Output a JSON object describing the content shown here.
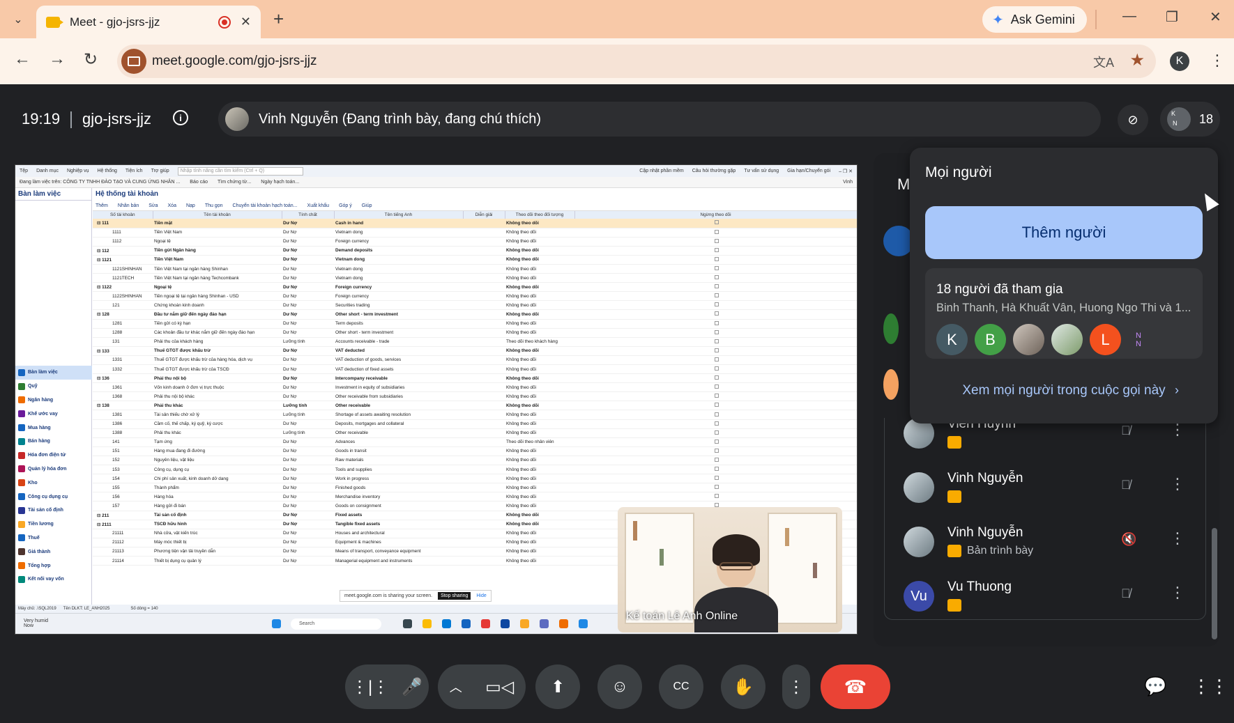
{
  "browser": {
    "tab_title": "Meet - gjo-jsrs-jjz",
    "url": "meet.google.com/gjo-jsrs-jjz",
    "gemini_label": "Ask Gemini",
    "profile_initial": "K"
  },
  "meeting": {
    "time": "19:19",
    "code": "gjo-jsrs-jjz",
    "presenter_label": "Vinh Nguyễn (Đang trình bày, đang chú thích)",
    "participant_count": "18"
  },
  "shared_screen": {
    "menu_items": [
      "Tệp",
      "Danh mục",
      "Nghiệp vụ",
      "Hệ thống",
      "Tiện ích",
      "Trợ giúp"
    ],
    "search_placeholder": "Nhập tính năng cần tìm kiếm (Ctrl + Q)",
    "right_links": [
      "Cập nhật phần mềm",
      "Câu hỏi thường gặp",
      "Tư vấn sử dụng",
      "Gia hạn/Chuyển gói"
    ],
    "company_bar": [
      "Đang làm việc trên: CÔNG TY TNHH ĐÀO TẠO VÀ CUNG ỨNG NHÂN ...",
      "Báo cáo",
      "Tìm chứng từ...",
      "Ngày hạch toán..."
    ],
    "user_name": "Vinh",
    "sidebar_header": "Bàn làm việc",
    "menu": [
      "Bàn làm việc",
      "Quỹ",
      "Ngân hàng",
      "Khế ước vay",
      "Mua hàng",
      "Bán hàng",
      "Hóa đơn điện tử",
      "Quản lý hóa đơn",
      "Kho",
      "Công cụ dụng cụ",
      "Tài sản cố định",
      "Tiền lương",
      "Thuế",
      "Giá thành",
      "Tổng hợp",
      "Kết nối vay vốn"
    ],
    "page_title": "Hệ thống tài khoản",
    "toolbar": [
      "Thêm",
      "Nhân bản",
      "Sửa",
      "Xóa",
      "Nạp",
      "Thu gọn",
      "Chuyển tài khoản hạch toán...",
      "Xuất khẩu",
      "Góp ý",
      "Giúp"
    ],
    "columns": [
      "Số tài khoản",
      "Tên tài khoản",
      "Tính chất",
      "Tên tiếng Anh",
      "Diễn giải",
      "Theo dõi theo đối tượng",
      "Ngừng theo dõi"
    ],
    "rows": [
      [
        "⊟ 111",
        "Tiền mặt",
        "Dư Nợ",
        "Cash in hand",
        "Không theo dõi"
      ],
      [
        "1111",
        "Tiền Việt Nam",
        "Dư Nợ",
        "Vietnam dong",
        "Không theo dõi"
      ],
      [
        "1112",
        "Ngoại tệ",
        "Dư Nợ",
        "Foreign currency",
        "Không theo dõi"
      ],
      [
        "⊟ 112",
        "Tiền gửi Ngân hàng",
        "Dư Nợ",
        "Demand deposits",
        "Không theo dõi"
      ],
      [
        "⊟ 1121",
        "Tiền Việt Nam",
        "Dư Nợ",
        "Vietnam dong",
        "Không theo dõi"
      ],
      [
        "1121SHINHAN",
        "Tiền Việt Nam tại ngân hàng Shinhan",
        "Dư Nợ",
        "Vietnam dong",
        "Không theo dõi"
      ],
      [
        "1121TECH",
        "Tiền Việt Nam tại ngân hàng Techcombank",
        "Dư Nợ",
        "Vietnam dong",
        "Không theo dõi"
      ],
      [
        "⊟ 1122",
        "Ngoại tệ",
        "Dư Nợ",
        "Foreign currency",
        "Không theo dõi"
      ],
      [
        "1122SHINHAN",
        "Tiền ngoại tệ tại ngân hàng Shinhan - USD",
        "Dư Nợ",
        "Foreign currency",
        "Không theo dõi"
      ],
      [
        "121",
        "Chứng khoán kinh doanh",
        "Dư Nợ",
        "Securities trading",
        "Không theo dõi"
      ],
      [
        "⊟ 128",
        "Đầu tư nắm giữ đến ngày đáo hạn",
        "Dư Nợ",
        "Other short - term investment",
        "Không theo dõi"
      ],
      [
        "1281",
        "Tiền gửi có kỳ hạn",
        "Dư Nợ",
        "Term deposits",
        "Không theo dõi"
      ],
      [
        "1288",
        "Các khoản đầu tư khác nắm giữ đến ngày đáo hạn",
        "Dư Nợ",
        "Other short - term investment",
        "Không theo dõi"
      ],
      [
        "131",
        "Phải thu của khách hàng",
        "Lưỡng tính",
        "Accounts receivable - trade",
        "Theo dõi theo khách hàng"
      ],
      [
        "⊟ 133",
        "Thuế GTGT được khấu trừ",
        "Dư Nợ",
        "VAT deducted",
        "Không theo dõi"
      ],
      [
        "1331",
        "Thuế GTGT được khấu trừ của hàng hóa, dịch vụ",
        "Dư Nợ",
        "VAT deduction of goods, services",
        "Không theo dõi"
      ],
      [
        "1332",
        "Thuế GTGT được khấu trừ của TSCĐ",
        "Dư Nợ",
        "VAT deduction of fixed assets",
        "Không theo dõi"
      ],
      [
        "⊟ 136",
        "Phải thu nội bộ",
        "Dư Nợ",
        "Intercompany receivable",
        "Không theo dõi"
      ],
      [
        "1361",
        "Vốn kinh doanh ở đơn vị trực thuộc",
        "Dư Nợ",
        "Investment in equity of subsidiaries",
        "Không theo dõi"
      ],
      [
        "1368",
        "Phải thu nội bộ khác",
        "Dư Nợ",
        "Other receivable from subsidiaries",
        "Không theo dõi"
      ],
      [
        "⊟ 138",
        "Phải thu khác",
        "Lưỡng tính",
        "Other receivable",
        "Không theo dõi"
      ],
      [
        "1381",
        "Tài sản thiếu chờ xử lý",
        "Lưỡng tính",
        "Shortage of assets awaiting resolution",
        "Không theo dõi"
      ],
      [
        "1386",
        "Cầm cố, thế chấp, ký quỹ, ký cược",
        "Dư Nợ",
        "Deposits, mortgages and collateral",
        "Không theo dõi"
      ],
      [
        "1388",
        "Phải thu khác",
        "Lưỡng tính",
        "Other receivable",
        "Không theo dõi"
      ],
      [
        "141",
        "Tạm ứng",
        "Dư Nợ",
        "Advances",
        "Theo dõi theo nhân viên"
      ],
      [
        "151",
        "Hàng mua đang đi đường",
        "Dư Nợ",
        "Goods in transit",
        "Không theo dõi"
      ],
      [
        "152",
        "Nguyên liệu, vật liệu",
        "Dư Nợ",
        "Raw materials",
        "Không theo dõi"
      ],
      [
        "153",
        "Công cụ, dụng cụ",
        "Dư Nợ",
        "Tools and supplies",
        "Không theo dõi"
      ],
      [
        "154",
        "Chi phí sản xuất, kinh doanh dở dang",
        "Dư Nợ",
        "Work in progress",
        "Không theo dõi"
      ],
      [
        "155",
        "Thành phẩm",
        "Dư Nợ",
        "Finished goods",
        "Không theo dõi"
      ],
      [
        "156",
        "Hàng hóa",
        "Dư Nợ",
        "Merchandise inventory",
        "Không theo dõi"
      ],
      [
        "157",
        "Hàng gửi đi bán",
        "Dư Nợ",
        "Goods on consignment",
        "Không theo dõi"
      ],
      [
        "⊟ 211",
        "Tài sản cố định",
        "Dư Nợ",
        "Fixed assets",
        "Không theo dõi"
      ],
      [
        "⊟ 2111",
        "TSCĐ hữu hình",
        "Dư Nợ",
        "Tangible fixed assets",
        "Không theo dõi"
      ],
      [
        "21111",
        "Nhà cửa, vật kiến trúc",
        "Dư Nợ",
        "Houses and architectural",
        "Không theo dõi"
      ],
      [
        "21112",
        "Máy móc thiết bị",
        "Dư Nợ",
        "Equipment & machines",
        "Không theo dõi"
      ],
      [
        "21113",
        "Phương tiện vận tải truyền dẫn",
        "Dư Nợ",
        "Means of transport, conveyance equipment",
        "Không theo dõi"
      ],
      [
        "21114",
        "Thiết bị dụng cụ quản lý",
        "Dư Nợ",
        "Managerial equipment and instruments",
        "Không theo dõi"
      ]
    ],
    "row_count": "Số dòng = 140",
    "status_left": "Máy chủ: .\\SQL2019",
    "status_db": "Tên DLKT: LE_ANH2025",
    "share_notice": "meet.google.com is sharing your screen.",
    "stop_sharing": "Stop sharing",
    "hide": "Hide",
    "weather_line1": "Very humid",
    "weather_line2": "Now",
    "taskbar_search": "Search"
  },
  "self_video": {
    "name": "Kế toán Lê Anh Online"
  },
  "people_panel": {
    "peek_title": "M",
    "participants": [
      {
        "name": "Vien Huynh",
        "sub": ""
      },
      {
        "name": "Vinh Nguyễn",
        "sub": ""
      },
      {
        "name": "Vinh Nguyễn",
        "sub": "Bản trình bày"
      },
      {
        "name": "Vu Thuong",
        "sub": "",
        "initials": "Vu"
      }
    ]
  },
  "popup": {
    "title": "Mọi người",
    "add_button": "Thêm người",
    "joined_title": "18 người đã tham gia",
    "joined_names": "Binh Thanh, Hà Khuất Vân, Huong Ngo Thi và 1...",
    "avatars": [
      {
        "letter": "K",
        "color": "#455a64"
      },
      {
        "letter": "B",
        "color": "#43a047"
      },
      {
        "letter": "",
        "color": "#8d8d8d"
      },
      {
        "letter": "",
        "color": "#9bb08c"
      },
      {
        "letter": "L",
        "color": "#f4511e"
      }
    ],
    "see_all": "Xem mọi người trong cuộc gọi này"
  }
}
